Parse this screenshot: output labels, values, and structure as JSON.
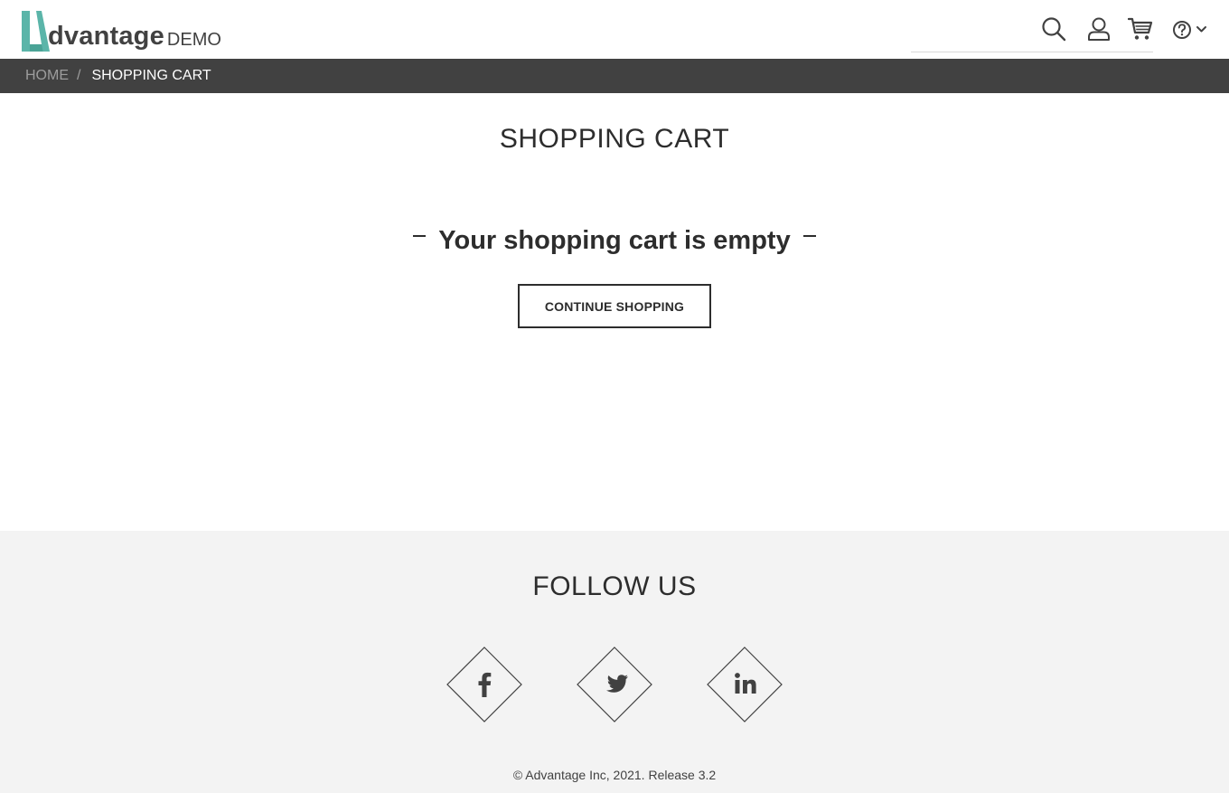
{
  "brand": {
    "logo_letter": "A",
    "logo_word": "dvantage",
    "logo_suffix": "DEMO",
    "accent_color": "#5bb5a9"
  },
  "header": {
    "icons": [
      "search-icon",
      "user-icon",
      "cart-icon",
      "help-icon",
      "chevron-down-icon"
    ]
  },
  "breadcrumb": {
    "home": "HOME",
    "separator": "/",
    "current": "SHOPPING CART"
  },
  "main": {
    "title": "SHOPPING CART",
    "empty_message": "Your shopping cart is empty",
    "continue_label": "CONTINUE SHOPPING"
  },
  "footer": {
    "follow_title": "FOLLOW US",
    "social": [
      "facebook-icon",
      "twitter-icon",
      "linkedin-icon"
    ],
    "copyright": "© Advantage Inc, 2021. Release 3.2"
  }
}
